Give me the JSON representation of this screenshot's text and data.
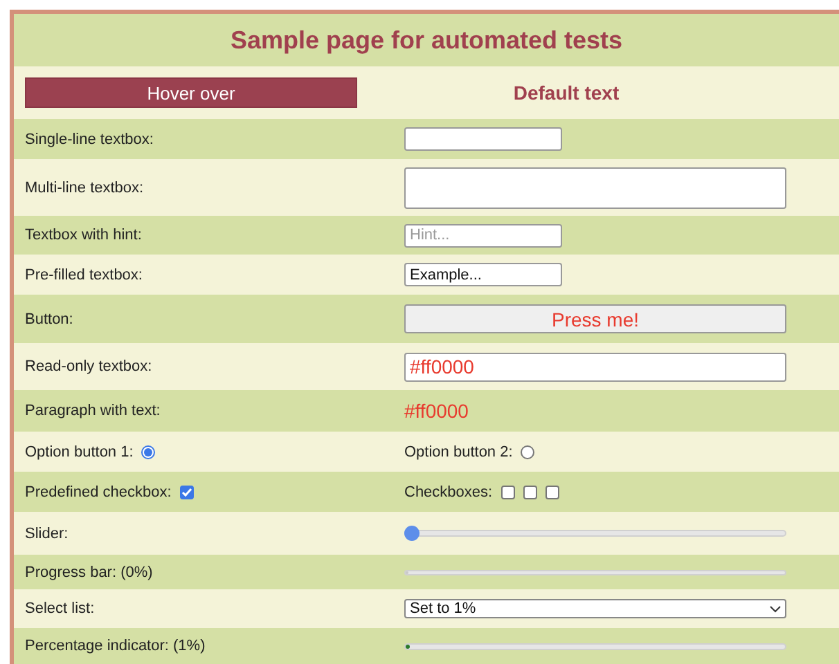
{
  "title": "Sample page for automated tests",
  "hover_button": "Hover over",
  "default_text": "Default text",
  "rows": [
    {
      "kind": "input",
      "label": "Single-line textbox:"
    },
    {
      "kind": "textarea",
      "label": "Multi-line textbox:"
    },
    {
      "kind": "input",
      "label": "Textbox with hint:",
      "placeholder": "Hint..."
    },
    {
      "kind": "input",
      "label": "Pre-filled textbox:",
      "value": "Example..."
    },
    {
      "kind": "button",
      "label": "Button:",
      "text": "Press me!"
    },
    {
      "kind": "readonly",
      "label": "Read-only textbox:",
      "value": "#ff0000"
    },
    {
      "kind": "paragraph",
      "label": "Paragraph with text:",
      "text": "#ff0000"
    },
    {
      "kind": "radios",
      "options": [
        {
          "label": "Option button 1:",
          "selected": true
        },
        {
          "label": "Option button 2:",
          "selected": false
        }
      ]
    },
    {
      "kind": "checkboxes",
      "checkbox": {
        "label": "Predefined checkbox:",
        "checked": true
      },
      "group": {
        "label": "Checkboxes:",
        "boxes": [
          {
            "checked": false
          },
          {
            "checked": false
          },
          {
            "checked": false
          }
        ]
      }
    },
    {
      "kind": "slider",
      "label": "Slider:",
      "level": 0
    },
    {
      "kind": "progress",
      "label": "Progress bar: (0%)",
      "level": 0
    },
    {
      "kind": "select",
      "label": "Select list:",
      "value": "Set to 1%"
    },
    {
      "kind": "meter",
      "label": "Percentage indicator: (1%)",
      "level": 0.01
    }
  ]
}
